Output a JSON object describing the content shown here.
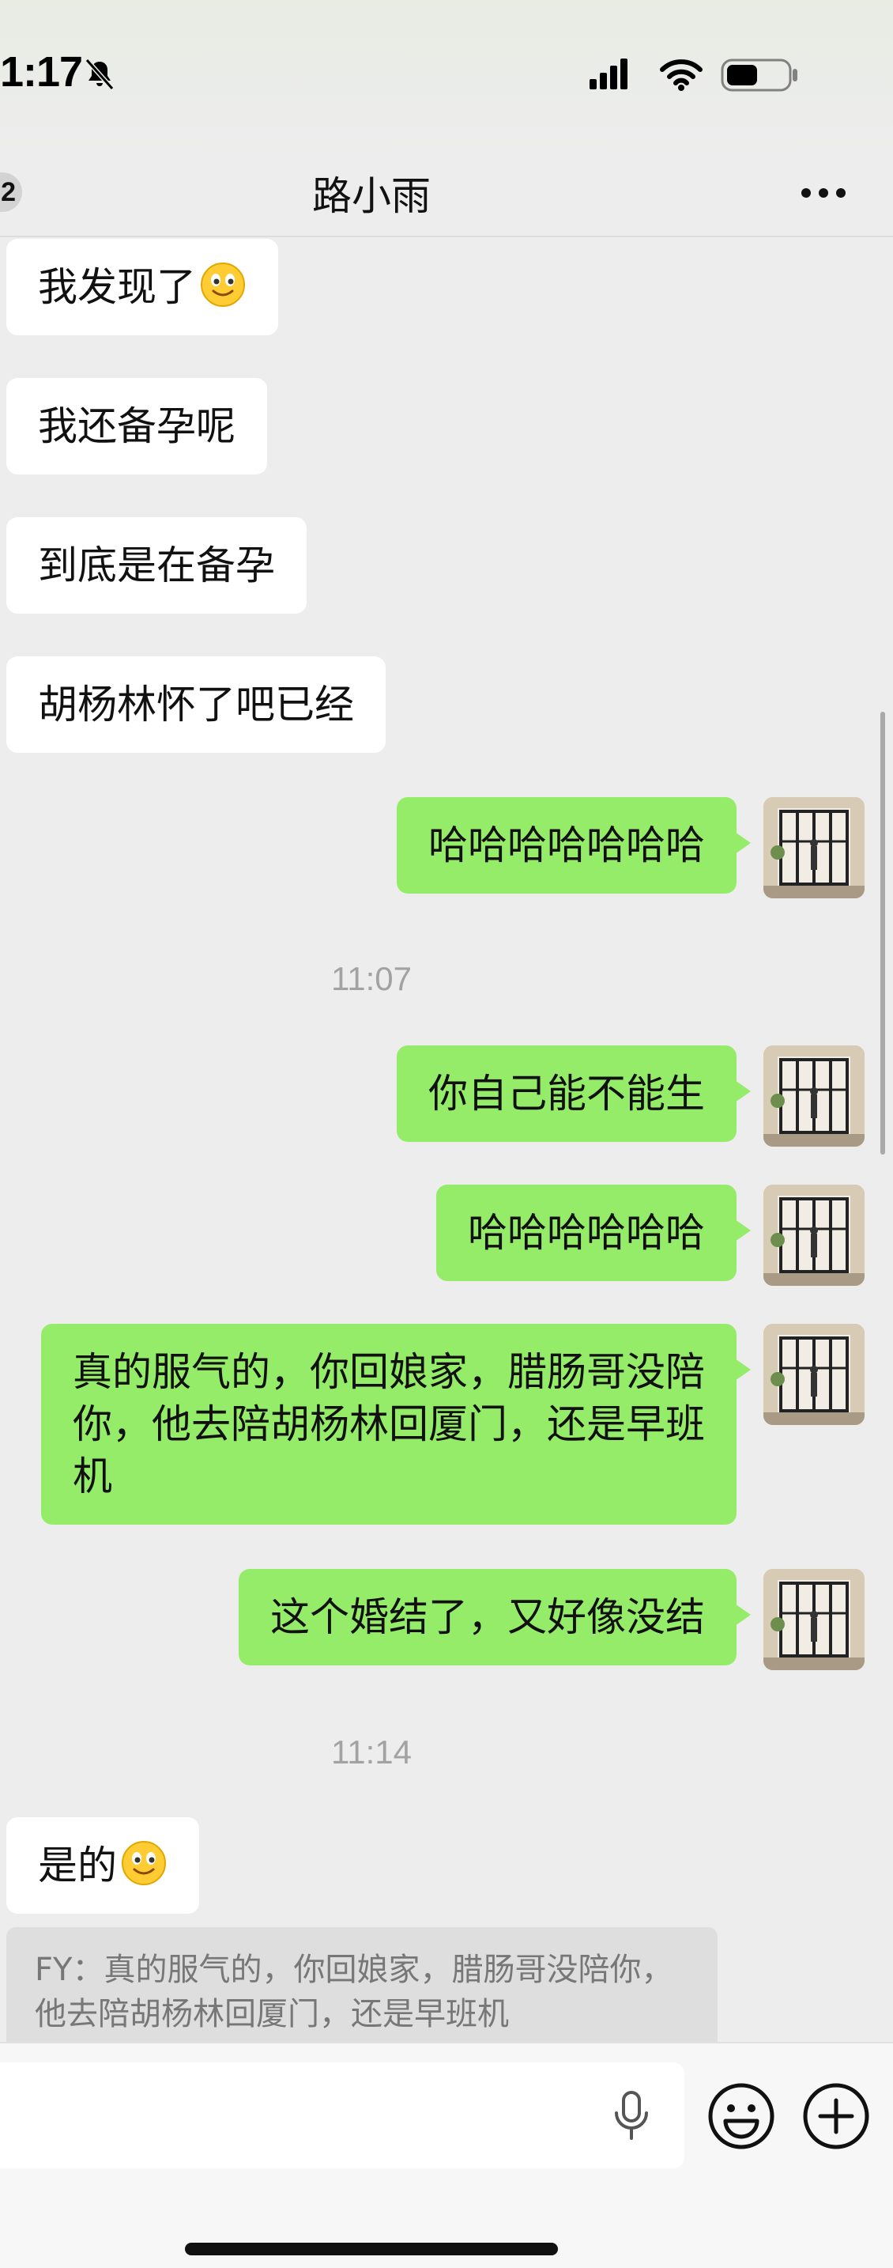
{
  "status_bar": {
    "time": "1:17",
    "icons": [
      "bell-slash-icon",
      "cellular-signal-icon",
      "wifi-icon",
      "battery-icon"
    ]
  },
  "nav": {
    "back_badge": "2",
    "title": "路小雨",
    "more_icon": "ellipsis-icon"
  },
  "messages": [
    {
      "side": "in",
      "text": "我发现了",
      "emoji": "smile-emoji"
    },
    {
      "side": "in",
      "text": "我还备孕呢"
    },
    {
      "side": "in",
      "text": "到底是在备孕"
    },
    {
      "side": "in",
      "text": "胡杨林怀了吧已经"
    },
    {
      "side": "out",
      "text": "哈哈哈哈哈哈哈"
    },
    {
      "type": "time",
      "text": "11:07"
    },
    {
      "side": "out",
      "text": "你自己能不能生"
    },
    {
      "side": "out",
      "text": "哈哈哈哈哈哈"
    },
    {
      "side": "out",
      "text": "真的服气的，你回娘家，腊肠哥没陪你，他去陪胡杨林回厦门，还是早班机"
    },
    {
      "side": "out",
      "text": "这个婚结了，又好像没结"
    },
    {
      "type": "time",
      "text": "11:14"
    },
    {
      "side": "in",
      "text": "是的",
      "emoji": "smile-emoji"
    }
  ],
  "quote": {
    "text": "FY：真的服气的，你回娘家，腊肠哥没陪你，他去陪胡杨林回厦门，还是早班机"
  },
  "input_bar": {
    "icons": [
      "microphone-icon",
      "emoji-icon",
      "plus-icon"
    ]
  },
  "colors": {
    "background": "#ededed",
    "outgoing_bubble": "#95ec69",
    "incoming_bubble": "#ffffff",
    "time_label": "#a2a2a2"
  }
}
